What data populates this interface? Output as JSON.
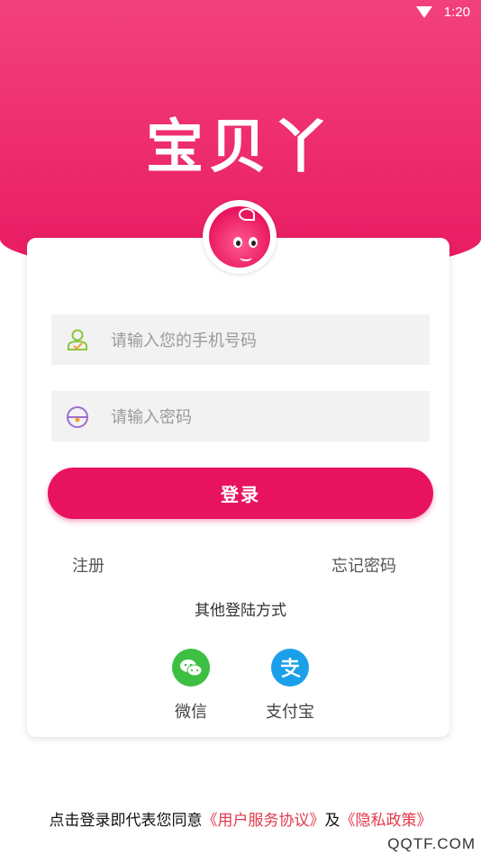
{
  "status": {
    "time": "1:20"
  },
  "brand": {
    "title": "宝贝丫"
  },
  "form": {
    "phone_placeholder": "请输入您的手机号码",
    "password_placeholder": "请输入密码",
    "login_label": "登录"
  },
  "links": {
    "register": "注册",
    "forgot": "忘记密码"
  },
  "other": {
    "title": "其他登陆方式",
    "wechat": "微信",
    "alipay": "支付宝"
  },
  "agreement": {
    "prefix": "点击登录即代表您同意",
    "terms": "《用户服务协议》",
    "and": "及",
    "privacy": "《隐私政策》"
  },
  "watermark": "QQTF.COM",
  "colors": {
    "accent": "#e8135f",
    "link": "#e23a4b",
    "wechat": "#3cbf42",
    "alipay": "#1aa0e8"
  }
}
